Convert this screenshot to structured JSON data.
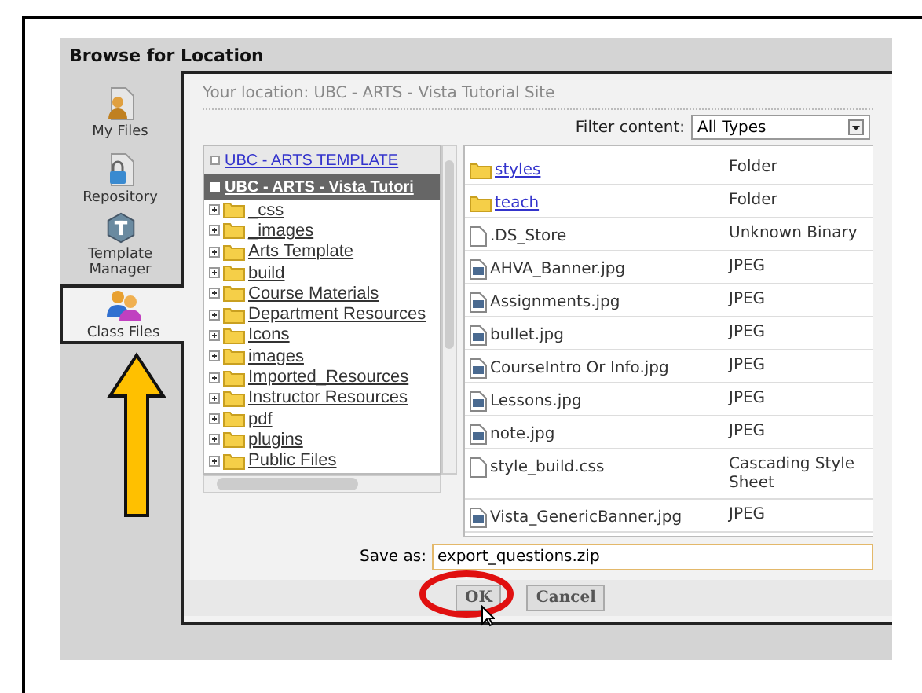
{
  "window": {
    "title": "Browse for Location"
  },
  "sidebar": {
    "items": [
      {
        "label": "My Files",
        "kind": "user",
        "selected": false
      },
      {
        "label": "Repository",
        "kind": "lock",
        "selected": false
      },
      {
        "label": "Template Manager",
        "kind": "template",
        "selected": false
      },
      {
        "label": "Class Files",
        "kind": "group",
        "selected": true
      }
    ]
  },
  "location": "Your location: UBC - ARTS - Vista Tutorial Site",
  "filter": {
    "label": "Filter content:",
    "value": "All Types"
  },
  "tree": [
    {
      "label": "UBC - ARTS TEMPLATE",
      "selected": false
    },
    {
      "label": "UBC - ARTS - Vista Tutori",
      "selected": true,
      "children": [
        {
          "label": "_css"
        },
        {
          "label": "_images"
        },
        {
          "label": "Arts Template"
        },
        {
          "label": "build"
        },
        {
          "label": "Course Materials"
        },
        {
          "label": "Department Resources"
        },
        {
          "label": "Icons"
        },
        {
          "label": "images"
        },
        {
          "label": "Imported_Resources"
        },
        {
          "label": "Instructor Resources"
        },
        {
          "label": "pdf"
        },
        {
          "label": "plugins"
        },
        {
          "label": "Public Files"
        }
      ]
    }
  ],
  "files": [
    {
      "name": "styles",
      "type": "Folder",
      "kind": "folder"
    },
    {
      "name": "teach",
      "type": "Folder",
      "kind": "folder"
    },
    {
      "name": ".DS_Store",
      "type": "Unknown Binary",
      "kind": "file"
    },
    {
      "name": "AHVA_Banner.jpg",
      "type": "JPEG",
      "kind": "image"
    },
    {
      "name": "Assignments.jpg",
      "type": "JPEG",
      "kind": "image"
    },
    {
      "name": "bullet.jpg",
      "type": "JPEG",
      "kind": "image"
    },
    {
      "name": "CourseIntro Or Info.jpg",
      "type": "JPEG",
      "kind": "image"
    },
    {
      "name": "Lessons.jpg",
      "type": "JPEG",
      "kind": "image"
    },
    {
      "name": "note.jpg",
      "type": "JPEG",
      "kind": "image"
    },
    {
      "name": "style_build.css",
      "type": "Cascading Style Sheet",
      "kind": "file"
    },
    {
      "name": "Vista_GenericBanner.jpg",
      "type": "JPEG",
      "kind": "image"
    }
  ],
  "save_as": {
    "label": "Save as:",
    "value": "export_questions.zip"
  },
  "buttons": [
    "OK",
    "Cancel"
  ]
}
